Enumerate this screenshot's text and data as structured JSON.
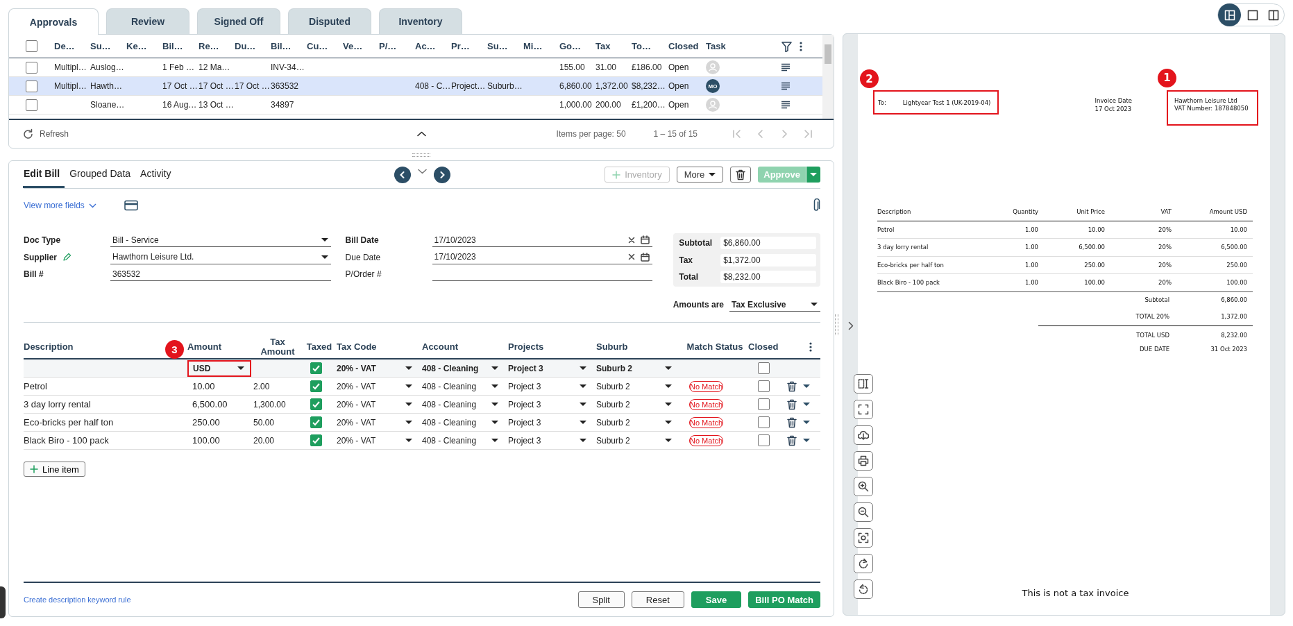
{
  "top_tabs": [
    {
      "label": "Approvals",
      "selected": true
    },
    {
      "label": "Review",
      "selected": false
    },
    {
      "label": "Signed Off",
      "selected": false
    },
    {
      "label": "Disputed",
      "selected": false
    },
    {
      "label": "Inventory",
      "selected": false
    }
  ],
  "bills_grid": {
    "header_checked": false,
    "columns": [
      "De…",
      "Su…",
      "Ke…",
      "Bil…",
      "Re…",
      "Du…",
      "Bil…",
      "Cu…",
      "Ve…",
      "P/…",
      "Ac…",
      "Pr…",
      "Su…",
      "Mi…",
      "Go…",
      "Tax",
      "To…",
      "Closed",
      "Task"
    ],
    "rows": [
      {
        "checked": false,
        "selected": false,
        "cells": [
          "Multipl…",
          "Auslog…",
          null,
          "1 Feb …",
          "12 Ma…",
          null,
          "INV-34…",
          null,
          null,
          null,
          null,
          null,
          null,
          null,
          "155.00",
          "31.00",
          "£186.00",
          "Open"
        ],
        "task": {
          "kind": "unassigned"
        }
      },
      {
        "checked": false,
        "selected": true,
        "cells": [
          "Multipl…",
          "Hawth…",
          null,
          "17 Oct …",
          "17 Oct …",
          "17 Oct …",
          "363532",
          null,
          null,
          null,
          "408 - C…",
          "Project…",
          "Suburb…",
          null,
          "6,860.00",
          "1,372.00",
          "$8,232…",
          "Open"
        ],
        "task": {
          "kind": "assigned",
          "initials": "MO"
        }
      },
      {
        "checked": false,
        "selected": false,
        "cells": [
          null,
          "Sloane…",
          null,
          "16 Aug…",
          "13 Oct …",
          null,
          "34897",
          null,
          null,
          null,
          null,
          null,
          null,
          null,
          "1,000.00",
          "200.00",
          "£1,200…",
          "Open"
        ],
        "task": {
          "kind": "unassigned"
        }
      }
    ],
    "refresh": "Refresh",
    "items_per_page": "Items per page: 50",
    "range": "1 – 15 of 15"
  },
  "edit_tabs": [
    {
      "label": "Edit Bill",
      "selected": true
    },
    {
      "label": "Grouped Data",
      "selected": false
    },
    {
      "label": "Activity",
      "selected": false
    }
  ],
  "toolbar": [
    {
      "kind": "add",
      "label": "Inventory",
      "disabled": true
    },
    {
      "kind": "menu",
      "label": "More",
      "disabled": false
    },
    {
      "kind": "delete",
      "disabled": false
    },
    {
      "kind": "split",
      "label": "Approve",
      "disabled": true
    }
  ],
  "view_more": "View more fields",
  "form": {
    "left": [
      {
        "label": "Doc Type",
        "value": "Bill - Service",
        "kind": "select",
        "required": true
      },
      {
        "label": "Supplier",
        "value": "Hawthorn Leisure Ltd.",
        "kind": "select",
        "required": true,
        "editable": true
      },
      {
        "label": "Bill #",
        "value": "363532",
        "kind": "text",
        "required": true
      }
    ],
    "middle": [
      {
        "label": "Bill Date",
        "value": "17/10/2023",
        "kind": "date",
        "required": true
      },
      {
        "label": "Due Date",
        "value": "17/10/2023",
        "kind": "date",
        "required": false
      },
      {
        "label": "P/Order #",
        "kind": "text",
        "required": false
      }
    ],
    "totals": [
      {
        "label": "Subtotal",
        "value": "$6,860.00"
      },
      {
        "label": "Tax",
        "value": "$1,372.00"
      },
      {
        "label": "Total",
        "value": "$8,232.00"
      }
    ],
    "amounts_are": {
      "label": "Amounts are",
      "value": "Tax Exclusive"
    }
  },
  "lines": {
    "columns": [
      "Description",
      "Amount",
      "Tax Amount",
      "Taxed",
      "Tax Code",
      "Account",
      "Projects",
      "Suburb",
      "Match Status",
      "Closed"
    ],
    "defaults": {
      "currency": "USD",
      "marker": "3",
      "taxed": true,
      "tax_code": "20% - VAT",
      "account": "408 - Cleaning",
      "project": "Project 3",
      "suburb": "Suburb 2",
      "closed": false
    },
    "rows": [
      {
        "description": "Petrol",
        "amount": "10.00",
        "tax_amount": "2.00",
        "taxed": true,
        "tax_code": "20% - VAT",
        "account": "408 - Cleaning",
        "project": "Project 3",
        "suburb": "Suburb 2",
        "match_status": "No Match",
        "closed": false
      },
      {
        "description": "3 day lorry rental",
        "amount": "6,500.00",
        "tax_amount": "1,300.00",
        "taxed": true,
        "tax_code": "20% - VAT",
        "account": "408 - Cleaning",
        "project": "Project 3",
        "suburb": "Suburb 2",
        "match_status": "No Match",
        "closed": false
      },
      {
        "description": "Eco-bricks per half ton",
        "amount": "250.00",
        "tax_amount": "50.00",
        "taxed": true,
        "tax_code": "20% - VAT",
        "account": "408 - Cleaning",
        "project": "Project 3",
        "suburb": "Suburb 2",
        "match_status": "No Match",
        "closed": false
      },
      {
        "description": "Black Biro - 100 pack",
        "amount": "100.00",
        "tax_amount": "20.00",
        "taxed": true,
        "tax_code": "20% - VAT",
        "account": "408 - Cleaning",
        "project": "Project 3",
        "suburb": "Suburb 2",
        "match_status": "No Match",
        "closed": false
      }
    ],
    "add_line": "Line item"
  },
  "footer": {
    "link": "Create description keyword rule",
    "buttons": [
      {
        "label": "Split",
        "kind": "secondary"
      },
      {
        "label": "Reset",
        "kind": "secondary"
      },
      {
        "label": "Save",
        "kind": "primary"
      },
      {
        "label": "Bill PO Match",
        "kind": "primary"
      }
    ]
  },
  "view_modes": [
    {
      "kind": "split",
      "selected": true
    },
    {
      "kind": "single",
      "selected": false
    },
    {
      "kind": "columns",
      "selected": false
    }
  ],
  "document": {
    "recipient": {
      "label": "To:",
      "value": "Lightyear Test 1 (UK-2019-04)",
      "marker": "2"
    },
    "invoice_date": {
      "label": "Invoice Date",
      "value": "17 Oct 2023"
    },
    "sender": {
      "lines": [
        "Hawthorn Leisure Ltd",
        "VAT Number: 187848050"
      ],
      "marker": "1"
    },
    "columns": [
      "Description",
      "Quantity",
      "Unit Price",
      "VAT",
      "Amount USD"
    ],
    "rows": [
      [
        "Petrol",
        "1.00",
        "10.00",
        "20%",
        "10.00"
      ],
      [
        "3 day lorry rental",
        "1.00",
        "6,500.00",
        "20%",
        "6,500.00"
      ],
      [
        "Eco-bricks per half ton",
        "1.00",
        "250.00",
        "20%",
        "250.00"
      ],
      [
        "Black Biro - 100 pack",
        "1.00",
        "100.00",
        "20%",
        "100.00"
      ]
    ],
    "summary": [
      {
        "label": "Subtotal",
        "value": "6,860.00",
        "rule_above": false
      },
      {
        "label": "TOTAL 20%",
        "value": "1,372.00",
        "rule_above": false
      },
      {
        "label": "TOTAL USD",
        "value": "8,232.00",
        "rule_above": true
      },
      {
        "label": "DUE DATE",
        "value": "31 Oct 2023",
        "rule_above": false
      }
    ],
    "note": "This is not a tax invoice"
  },
  "doc_tools": [
    {
      "kind": "text-select"
    },
    {
      "kind": "fullscreen"
    },
    {
      "kind": "download"
    },
    {
      "kind": "print"
    },
    {
      "kind": "zoom-in"
    },
    {
      "kind": "zoom-out"
    },
    {
      "kind": "focus"
    },
    {
      "kind": "rotate-right"
    },
    {
      "kind": "rotate-left"
    }
  ]
}
